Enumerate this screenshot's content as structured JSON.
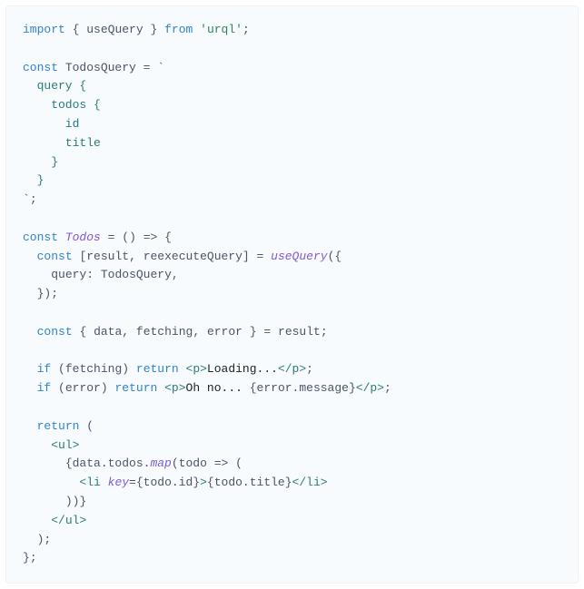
{
  "code": {
    "l01_import": "import",
    "l01_brace_o": "{",
    "l01_useQuery": "useQuery",
    "l01_brace_c": "}",
    "l01_from": "from",
    "l01_str": "'urql'",
    "l01_semi": ";",
    "l03_const": "const",
    "l03_name": "TodosQuery",
    "l03_eq": "=",
    "l03_btick": "`",
    "l04": "  query {",
    "l05": "    todos {",
    "l06": "      id",
    "l07": "      title",
    "l08": "    }",
    "l09": "  }",
    "l10_btick": "`",
    "l10_semi": ";",
    "l12_const": "const",
    "l12_name": "Todos",
    "l12_eq": "=",
    "l12_par_o": "(",
    "l12_par_c": ")",
    "l12_arrow": "=>",
    "l12_brace_o": "{",
    "l13_const": "const",
    "l13_br_o": "[",
    "l13_result": "result",
    "l13_comma": ",",
    "l13_reexec": "reexecuteQuery",
    "l13_br_c": "]",
    "l13_eq": "=",
    "l13_use": "useQuery",
    "l13_po": "(",
    "l13_bo": "{",
    "l14_query": "query",
    "l14_colon": ":",
    "l14_val": "TodosQuery",
    "l14_comma": ",",
    "l15_bc": "}",
    "l15_pc": ")",
    "l15_semi": ";",
    "l17_const": "const",
    "l17_bo": "{",
    "l17_data": "data",
    "l17_c1": ",",
    "l17_fetch": "fetching",
    "l17_c2": ",",
    "l17_error": "error",
    "l17_bc": "}",
    "l17_eq": "=",
    "l17_res": "result",
    "l17_semi": ";",
    "l19_if": "if",
    "l19_po": "(",
    "l19_cond": "fetching",
    "l19_pc": ")",
    "l19_return": "return",
    "l19_tag_o": "<p>",
    "l19_text": "Loading...",
    "l19_tag_c": "</p>",
    "l19_semi": ";",
    "l20_if": "if",
    "l20_po": "(",
    "l20_cond": "error",
    "l20_pc": ")",
    "l20_return": "return",
    "l20_tag_o": "<p>",
    "l20_text": "Oh no... ",
    "l20_ebo": "{",
    "l20_expr": "error.message",
    "l20_ebc": "}",
    "l20_tag_c": "</p>",
    "l20_semi": ";",
    "l22_return": "return",
    "l22_po": "(",
    "l23_ul_o": "<ul>",
    "l24_ebo": "{",
    "l24_data": "data.todos.",
    "l24_map": "map",
    "l24_po": "(",
    "l24_todo": "todo",
    "l24_arrow": "=>",
    "l24_po2": "(",
    "l25_li_o": "<li",
    "l25_sp": " ",
    "l25_key": "key",
    "l25_eq": "=",
    "l25_kbo": "{",
    "l25_kexpr": "todo.id",
    "l25_kbc": "}",
    "l25_gt": ">",
    "l25_vbo": "{",
    "l25_vexpr": "todo.title",
    "l25_vbc": "}",
    "l25_li_c": "</li>",
    "l26_pc": ")",
    "l26_pc2": ")",
    "l26_ebc": "}",
    "l27_ul_c": "</ul>",
    "l28_pc": ")",
    "l28_semi": ";",
    "l29_bc": "}",
    "l29_semi": ";"
  }
}
